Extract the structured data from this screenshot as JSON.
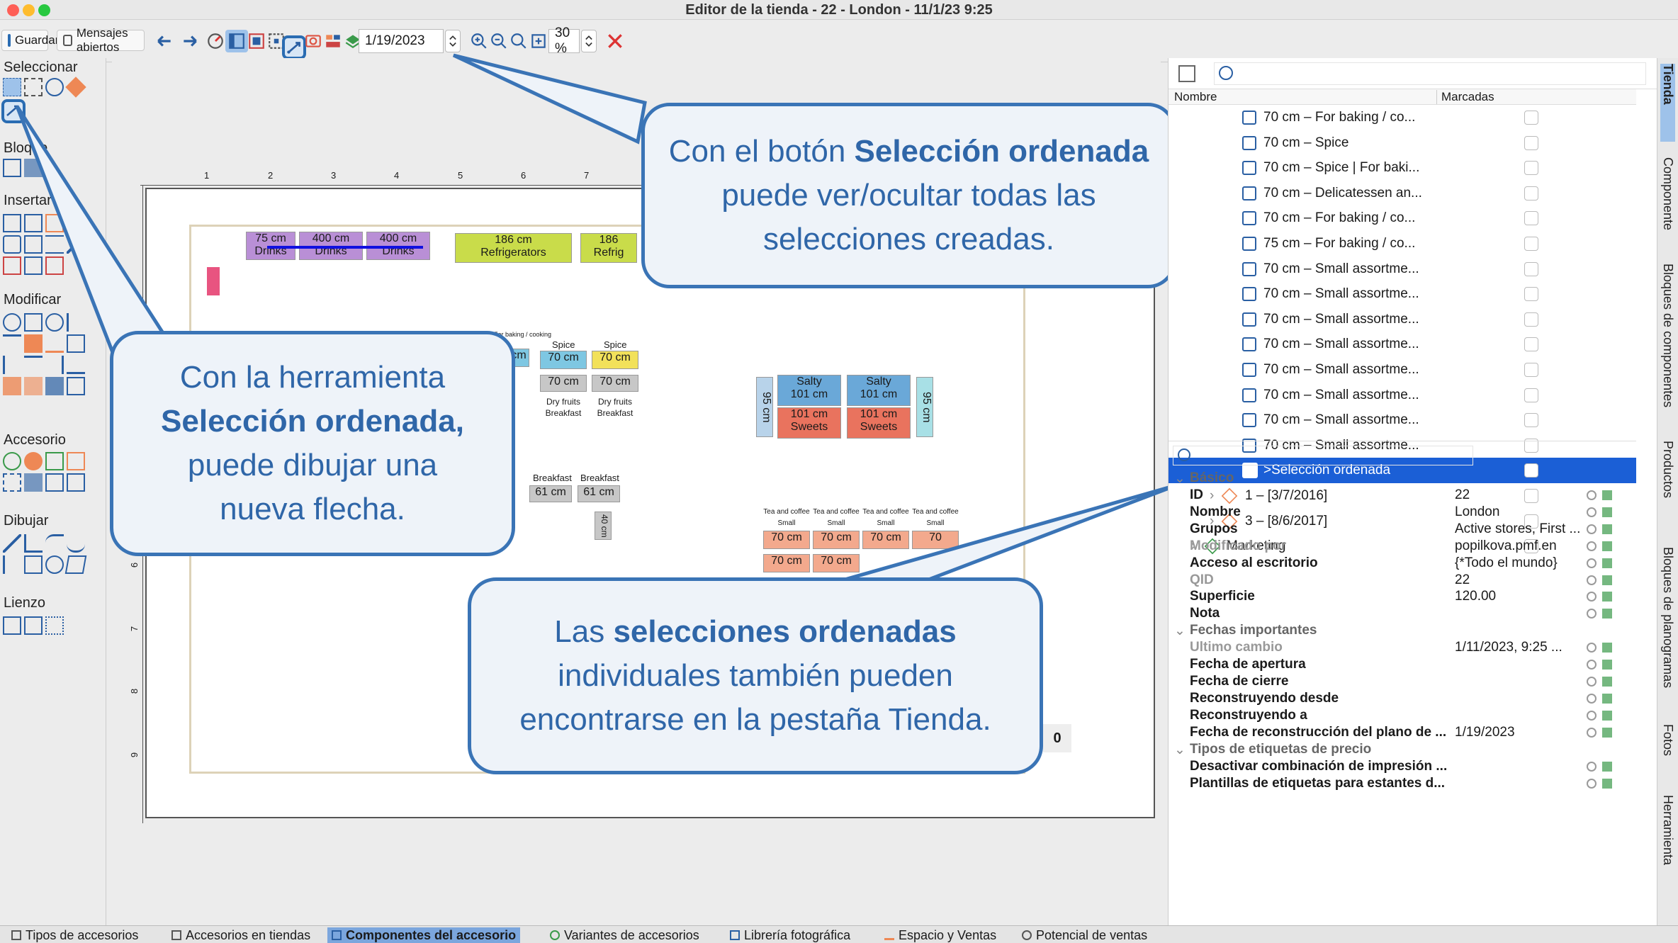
{
  "window": {
    "title": "Editor de la tienda - 22 - London - 11/1/23 9:25"
  },
  "toolbar": {
    "save_label": "Guardar",
    "messages_label": "Mensajes abiertos",
    "date_value": "1/19/2023",
    "zoom_value": "30 %"
  },
  "left_panel": {
    "sections": [
      "Seleccionar",
      "Bloque",
      "Insertar",
      "Modificar",
      "Accesorio",
      "Dibujar",
      "Lienzo"
    ]
  },
  "canvas": {
    "ruler_marks": [
      "1",
      "2",
      "3",
      "4",
      "5",
      "6",
      "7"
    ],
    "ruler_left_marks": [
      "2",
      "6",
      "7",
      "8",
      "9"
    ],
    "top_blocks": [
      {
        "size": "75 cm",
        "label": "Drinks",
        "color": "#b98fd6"
      },
      {
        "size": "400 cm",
        "label": "Drinks",
        "color": "#b98fd6"
      },
      {
        "size": "400 cm",
        "label": "Drinks",
        "color": "#b98fd6"
      },
      {
        "size": "186 cm",
        "label": "Refrigerators",
        "color": "#c9dc4a"
      },
      {
        "size": "186",
        "label": "Refrig",
        "color": "#c9dc4a"
      }
    ],
    "mid_blocks": [
      {
        "head": "For baking / cooking",
        "size": "cm",
        "label": "",
        "color": "#7ec7e2"
      },
      {
        "head": "Spice",
        "size": "70 cm",
        "label": "Dry fruits Breakfast",
        "color": "#7ec7e2"
      },
      {
        "head": "Spice",
        "size": "70 cm",
        "label": "Dry fruits Breakfast",
        "color": "#f2e15a"
      }
    ],
    "salty_blocks": [
      {
        "top": "Salty",
        "size": "101 cm",
        "bottom_size": "101 cm",
        "bottom": "Sweets"
      },
      {
        "top": "Salty",
        "size": "101 cm",
        "bottom_size": "101 cm",
        "bottom": "Sweets"
      }
    ],
    "side_95": [
      "95 cm",
      "95 cm"
    ],
    "breakfast_blocks": [
      {
        "head": "Breakfast",
        "size": "61 cm"
      },
      {
        "head": "Breakfast",
        "size": "61 cm"
      }
    ],
    "small_40": "40 cm",
    "tea_blocks": [
      {
        "head": "Tea and coffee",
        "sub": "Small assortment",
        "size": "70 cm"
      },
      {
        "head": "Tea and coffee",
        "sub": "Small assortment",
        "size": "70 cm"
      },
      {
        "head": "Tea and coffee",
        "sub": "Small assortment",
        "size": "70 cm"
      },
      {
        "head": "Tea and coffee",
        "sub": "Small assortment",
        "size": "70"
      }
    ],
    "tea_row2": [
      "70 cm",
      "70 cm"
    ],
    "stray_zero": "0",
    "misc_tags": [
      "cm",
      "fruits",
      "kfast",
      "ast",
      "m",
      "Drinks"
    ]
  },
  "callouts": {
    "top": {
      "pre": "Con el botón ",
      "bold1": "Selección ordenada",
      "post": " puede ver/ocultar todas las selecciones creadas."
    },
    "left": {
      "pre": "Con la herramienta ",
      "bold1": "Selección ordenada,",
      "post": " puede dibujar una nueva flecha."
    },
    "bottom": {
      "pre": "Las ",
      "bold1": "selecciones ordenadas",
      "post": " individuales también pueden encontrarse en la pestaña Tienda."
    }
  },
  "tree": {
    "col_name": "Nombre",
    "col_marked": "Marcadas",
    "rows": [
      "70 cm – For baking / co...",
      "70 cm – Spice",
      "70 cm – Spice | For baki...",
      "70 cm – Delicatessen an...",
      "70 cm – For baking / co...",
      "75 cm – For baking / co...",
      "70 cm – Small assortme...",
      "70 cm – Small assortme...",
      "70 cm – Small assortme...",
      "70 cm – Small assortme...",
      "70 cm – Small assortme...",
      "70 cm – Small assortme...",
      "70 cm – Small assortme...",
      "70 cm – Small assortme..."
    ],
    "selected": ">Selección ordenada",
    "groups": [
      "1 – [3/7/2016]",
      "3 – [8/6/2017]"
    ],
    "marketing": "Marketing"
  },
  "properties": {
    "sections": [
      "Básico",
      "Fechas importantes",
      "Tipos de etiquetas de precio"
    ],
    "basic": [
      {
        "k": "ID",
        "v": "22",
        "muted": false
      },
      {
        "k": "Nombre",
        "v": "London",
        "muted": false
      },
      {
        "k": "Grupos",
        "v": "Active stores, First ...",
        "muted": false
      },
      {
        "k": "Modificado por",
        "v": "popilkova.pmf.en",
        "muted": true
      },
      {
        "k": "Acceso al escritorio",
        "v": "{*Todo el mundo}",
        "muted": false
      },
      {
        "k": "QID",
        "v": "22",
        "muted": true
      },
      {
        "k": "Superficie",
        "v": "120.00",
        "muted": false
      },
      {
        "k": "Nota",
        "v": "",
        "muted": false
      }
    ],
    "dates": [
      {
        "k": "Ultimo cambio",
        "v": "1/11/2023, 9:25 ...",
        "muted": true
      },
      {
        "k": "Fecha de apertura",
        "v": "",
        "muted": false
      },
      {
        "k": "Fecha de cierre",
        "v": "",
        "muted": false
      },
      {
        "k": "Reconstruyendo desde",
        "v": "",
        "muted": false
      },
      {
        "k": "Reconstruyendo a",
        "v": "",
        "muted": false
      },
      {
        "k": "Fecha de reconstrucción del plano de ...",
        "v": "1/19/2023",
        "muted": false
      }
    ],
    "labels": [
      {
        "k": "Desactivar combinación de impresión ...",
        "v": ""
      },
      {
        "k": "Plantillas de etiquetas para estantes d...",
        "v": ""
      }
    ]
  },
  "side_tabs": [
    "Tienda",
    "Componente",
    "Bloques de componentes",
    "Productos",
    "Bloques de planogramas",
    "Fotos",
    "Herramienta"
  ],
  "bottom_tabs": [
    "Tipos de accesorios",
    "Accesorios en tiendas",
    "Componentes del accesorio",
    "Variantes de accesorios",
    "Librería fotográfica",
    "Espacio y Ventas",
    "Potencial de ventas"
  ]
}
